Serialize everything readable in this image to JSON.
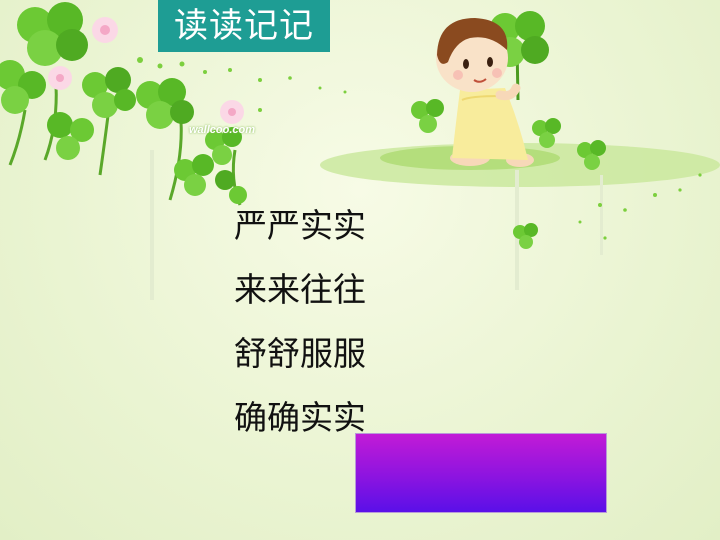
{
  "slide": {
    "title": "读读记记",
    "watermark": "wallcoo.com",
    "phrases": [
      "严严实实",
      "来来往往",
      "舒舒服服",
      "确确实实"
    ]
  },
  "colors": {
    "title_bg": "#1e9d94",
    "title_text": "#ffffff",
    "background": "#eef6d6",
    "leaf_green": "#5cbf2a",
    "purple_top": "#c21bd6",
    "purple_bottom": "#5a10e8"
  },
  "icons": [
    "clover-icon",
    "flower-icon",
    "girl-illustration"
  ]
}
